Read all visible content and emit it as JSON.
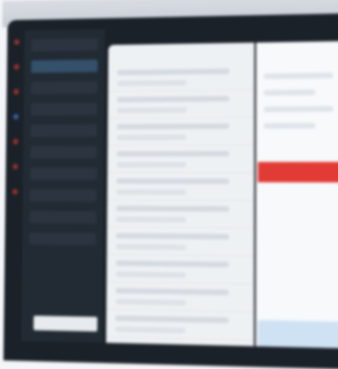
{
  "rail": {
    "icons": [
      "inbox-icon",
      "star-icon",
      "chat-icon",
      "calendar-icon",
      "folder-icon",
      "bell-icon",
      "user-icon"
    ]
  },
  "sidebar": {
    "items": [
      "",
      "",
      "",
      "",
      "",
      "",
      "",
      "",
      "",
      ""
    ],
    "active_index": 1,
    "bottom_label": ""
  },
  "list": {
    "header": "",
    "rows": 10
  },
  "detail": {
    "header": "",
    "alert_text": ""
  },
  "colors": {
    "sidebar_bg": "#222a33",
    "rail_bg": "#1b2129",
    "accent_red": "#e23b35",
    "accent_blue": "#3b78c9"
  }
}
